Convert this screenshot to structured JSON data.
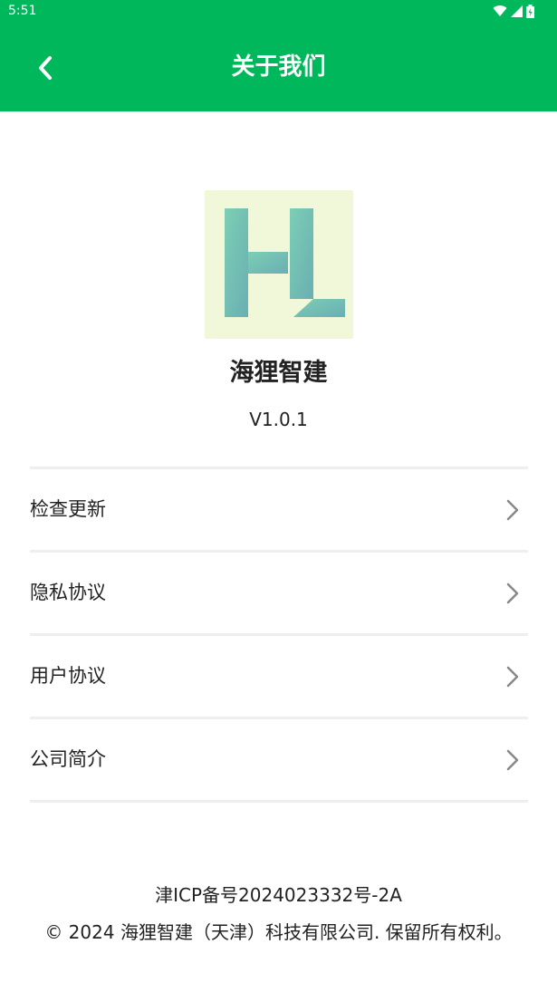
{
  "status_bar": {
    "time": "5:51",
    "icons": [
      "wifi-icon",
      "signal-icon",
      "battery-icon"
    ]
  },
  "header": {
    "title": "关于我们",
    "back_icon": "chevron-left-icon",
    "background_color": "#00b85c"
  },
  "app": {
    "name": "海狸智建",
    "version": "V1.0.1",
    "logo_icon": "hl-logo-icon"
  },
  "menu": {
    "items": [
      {
        "label": "检查更新"
      },
      {
        "label": "隐私协议"
      },
      {
        "label": "用户协议"
      },
      {
        "label": "公司简介"
      }
    ],
    "chevron_icon": "chevron-right-icon"
  },
  "footer": {
    "icp": "津ICP备号2024023332号-2A",
    "copyright": "© 2024 海狸智建（天津）科技有限公司. 保留所有权利。"
  }
}
